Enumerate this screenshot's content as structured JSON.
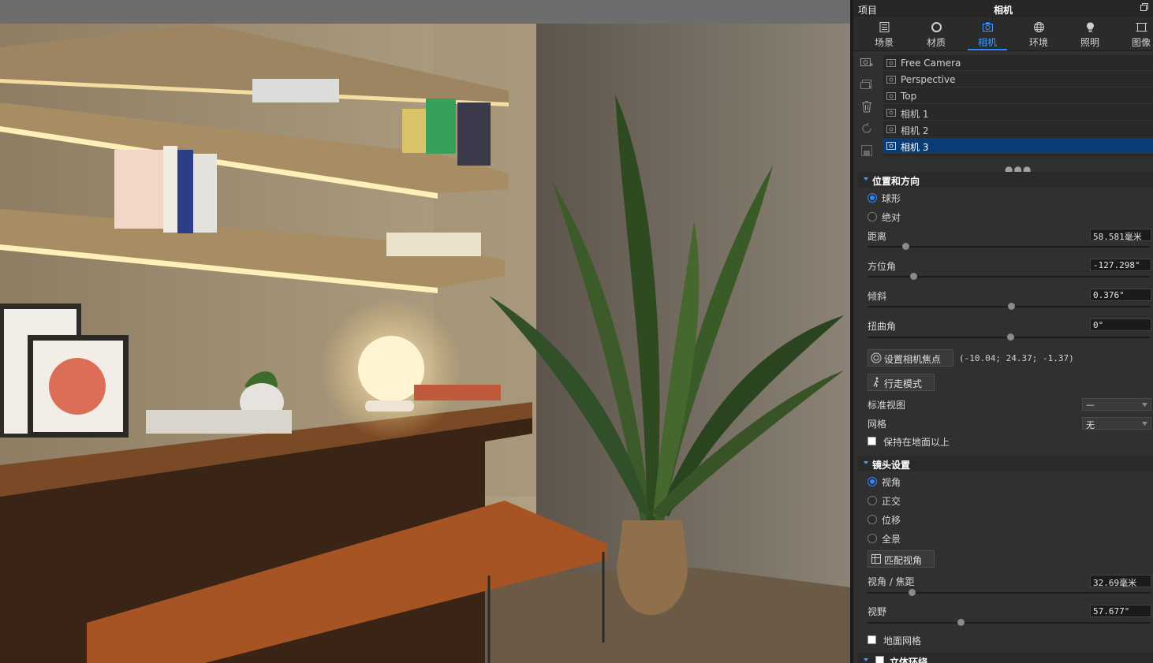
{
  "panel": {
    "header_left": "项目",
    "header_title": "相机",
    "tabs": [
      {
        "label": "场景",
        "icon": "scene-icon"
      },
      {
        "label": "材质",
        "icon": "material-icon"
      },
      {
        "label": "相机",
        "icon": "camera-icon"
      },
      {
        "label": "环境",
        "icon": "environment-icon"
      },
      {
        "label": "照明",
        "icon": "lighting-icon"
      },
      {
        "label": "图像",
        "icon": "image-icon"
      }
    ],
    "active_tab": "相机",
    "cameras": [
      "Free Camera",
      "Perspective",
      "Top",
      "相机 1",
      "相机 2",
      "相机 3"
    ],
    "selected_camera": "相机 3",
    "position": {
      "title": "位置和方向",
      "mode_spherical": "球形",
      "mode_absolute": "绝对",
      "distance_label": "距离",
      "distance_value": "58.581毫米",
      "azimuth_label": "方位角",
      "azimuth_value": "-127.298°",
      "tilt_label": "倾斜",
      "tilt_value": "0.376°",
      "twist_label": "扭曲角",
      "twist_value": "0°",
      "focus_button": "设置相机焦点",
      "focus_coords": "(-10.04; 24.37; -1.37)",
      "walk_button": "行走模式",
      "standard_view_label": "标准视图",
      "standard_view_value": "—",
      "grid_label": "网格",
      "grid_value": "无",
      "keep_above_ground": "保持在地面以上"
    },
    "lens": {
      "title": "镜头设置",
      "mode_fov": "视角",
      "mode_ortho": "正交",
      "mode_shift": "位移",
      "mode_panorama": "全景",
      "match_button": "匹配视角",
      "focal_label": "视角 / 焦距",
      "focal_value": "32.69毫米",
      "fov_label": "视野",
      "fov_value": "57.677°",
      "ground_grid": "地面网格"
    },
    "stereo_title": "立体环绕"
  },
  "colors": {
    "accent": "#2f86ff",
    "selection": "#0a3c78",
    "panel_bg": "#303030"
  }
}
